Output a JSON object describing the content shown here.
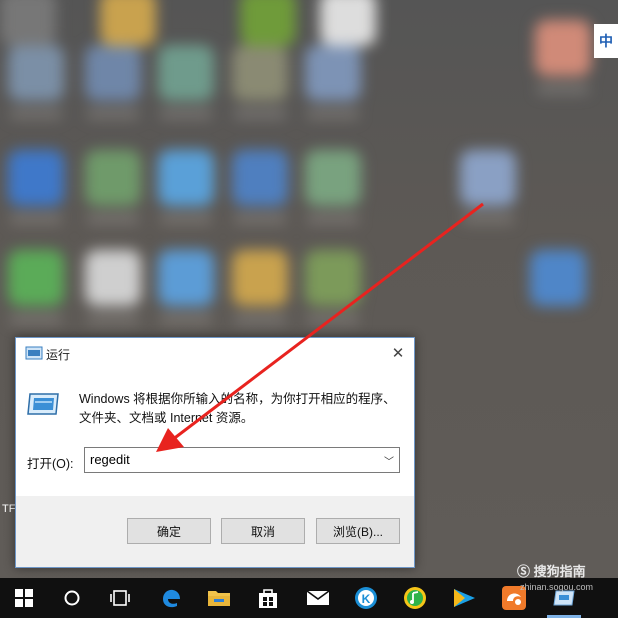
{
  "desktop": {
    "ime_indicator": "中",
    "stray_label": "TF",
    "icon_colors": [
      "#7b8fa6",
      "#6f86a8",
      "#6f9b8c",
      "#8a8a73",
      "#7d93b5",
      "#3f78c9",
      "#6f9a6a",
      "#5aa0d8",
      "#4f7fbf",
      "#79a27f",
      "#5bab58",
      "#cfcfcf",
      "#5c9cd6",
      "#c9a24e",
      "#7c9a5a",
      "#8aa0c4",
      "#d08a78"
    ]
  },
  "run_dialog": {
    "title": "运行",
    "description": "Windows 将根据你所输入的名称，为你打开相应的程序、文件夹、文档或 Internet 资源。",
    "open_label": "打开(O):",
    "open_value": "regedit",
    "buttons": {
      "ok": "确定",
      "cancel": "取消",
      "browse": "浏览(B)..."
    }
  },
  "taskbar": {
    "icons": [
      "windows-start-icon",
      "search-circle-icon",
      "task-view-icon",
      "edge-browser-icon",
      "file-explorer-icon",
      "store-icon",
      "mail-icon",
      "k-app-icon",
      "music-app-icon",
      "video-player-icon",
      "uc-browser-icon",
      "run-app-icon"
    ]
  },
  "watermark": {
    "text": "搜狗指南",
    "sub": "zhinan.sogou.com"
  },
  "annotation": {
    "arrow_color": "#e8231f"
  }
}
